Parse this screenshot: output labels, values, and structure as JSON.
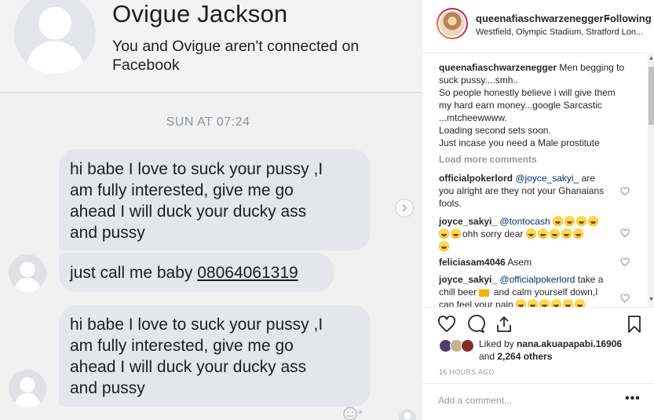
{
  "messenger": {
    "contact_name": "Ovigue Jackson",
    "connection_note": "You and Ovigue aren't connected on Facebook",
    "timestamp": "SUN AT 07:24",
    "messages": [
      {
        "lines": [
          "hi babe I love to suck your pussy ,I",
          "am fully interested, give me go",
          "ahead I will duck your ducky ass",
          "and pussy"
        ]
      },
      {
        "prefix": "just call me baby ",
        "phone": "08064061319"
      },
      {
        "lines": [
          "hi babe I love to suck your pussy ,I",
          "am fully interested, give me go",
          "ahead I will duck your ducky ass",
          "and pussy"
        ]
      }
    ]
  },
  "instagram": {
    "username": "queenafiaschwarzenegger",
    "separator": "•",
    "follow_status": "Following",
    "location": "Westfield, Olympic Stadium, Stratford Lon...",
    "caption": {
      "user": "queenafiaschwarzenegger",
      "lines": [
        "Men begging to suck pussy....smh..",
        "So people honestly believe i will give them my hard earn money...google Sarcastic ...mtcheewwww.",
        "Loading second sets soon.",
        "Just incase you need a Male prostitute"
      ]
    },
    "load_more": "Load more comments",
    "comments": [
      {
        "user": "officialpokerlord",
        "mention": "@joyce_sakyi_",
        "text": " are you alright are they not your Ghanaians fools."
      },
      {
        "user": "joyce_sakyi_",
        "mention": "@tontocash",
        "text": "ohh sorry dear"
      },
      {
        "user": "feliciasam4046",
        "mention": "",
        "text": " Asem"
      },
      {
        "user": "joyce_sakyi_",
        "mention": "@officialpokerlord",
        "text": " take a chill beer",
        "text2": " and calm yourself down,I can feel your pain"
      }
    ],
    "liked_by_prefix": "Liked by ",
    "liked_by_user": "nana.akuapapabi.16906",
    "liked_by_suffix": "and ",
    "liked_count": "2,264 others",
    "post_time": "16 HOURS AGO",
    "comment_placeholder": "Add a comment...",
    "more_options": "•••",
    "icons": [
      "heart-icon",
      "comment-icon",
      "share-icon",
      "bookmark-icon"
    ]
  }
}
